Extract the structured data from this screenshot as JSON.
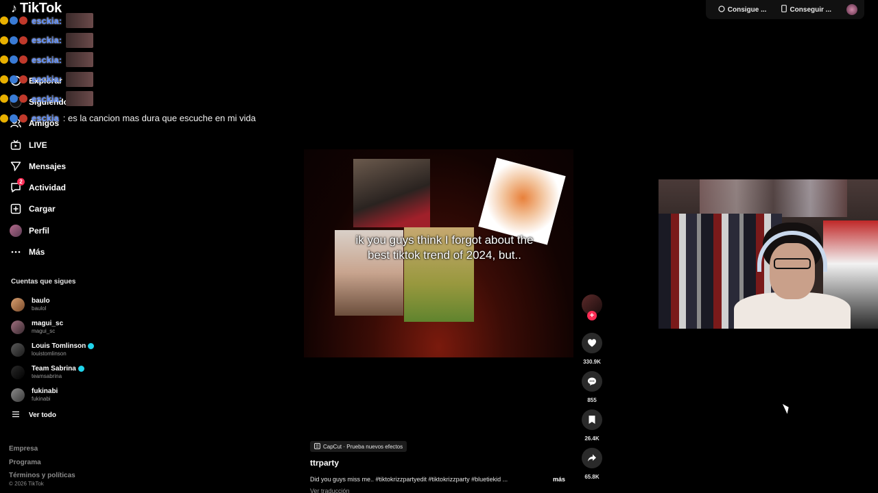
{
  "app": {
    "brand": "TikTok"
  },
  "nav": {
    "items": [
      {
        "label": "Explorar",
        "icon": "compass-icon"
      },
      {
        "label": "Siguiendo",
        "icon": "following-icon"
      },
      {
        "label": "Amigos",
        "icon": "friends-icon"
      },
      {
        "label": "LIVE",
        "icon": "live-icon"
      },
      {
        "label": "Mensajes",
        "icon": "messages-icon"
      },
      {
        "label": "Actividad",
        "icon": "activity-icon",
        "badge": "2"
      },
      {
        "label": "Cargar",
        "icon": "upload-icon"
      },
      {
        "label": "Perfil",
        "icon": "profile-avatar"
      },
      {
        "label": "Más",
        "icon": "more-icon"
      }
    ]
  },
  "following": {
    "title": "Cuentas que sigues",
    "accounts": [
      {
        "name": "baulo",
        "user": "baulol",
        "verified": false
      },
      {
        "name": "magui_sc",
        "user": "magui_sc",
        "verified": false
      },
      {
        "name": "Louis Tomlinson",
        "user": "louistomlinson",
        "verified": true
      },
      {
        "name": "Team Sabrina",
        "user": "teamsabrina",
        "verified": true
      },
      {
        "name": "fukinabi",
        "user": "fukinabi",
        "verified": false
      }
    ],
    "see_all": "Ver todo"
  },
  "footer": {
    "links": [
      "Empresa",
      "Programa",
      "Términos y políticas"
    ],
    "copyright": "© 2026 TikTok"
  },
  "chat": {
    "rows": [
      {
        "user": "esckia:",
        "message": ""
      },
      {
        "user": "esckia:",
        "message": ""
      },
      {
        "user": "esckia:",
        "message": ""
      },
      {
        "user": "esckia:",
        "message": ""
      },
      {
        "user": "esckia:",
        "message": ""
      },
      {
        "user": "esckia",
        "message": ": es la cancion mas dura que escuche en mi vida"
      }
    ]
  },
  "topbar": {
    "btn1": "Consigue ...",
    "btn2": "Conseguir ..."
  },
  "video": {
    "overlay_line1": "ik you guys think I forgot about the",
    "overlay_line2": "best tiktok trend of 2024, but.."
  },
  "actions": {
    "likes": "330.9K",
    "comments": "855",
    "saves": "26.4K",
    "shares": "65.8K"
  },
  "caption": {
    "capcut": "CapCut · Prueba nuevos efectos",
    "author": "ttrparty",
    "description": "Did you guys miss me.. #tiktokrizzpartyedit #tiktokrizzparty #bluetiekid ...",
    "more": "más",
    "translate": "Ver traducción"
  },
  "colors": {
    "accent": "#fe2c55",
    "verified": "#20d5ec",
    "chat_user": "#5b8cff"
  }
}
